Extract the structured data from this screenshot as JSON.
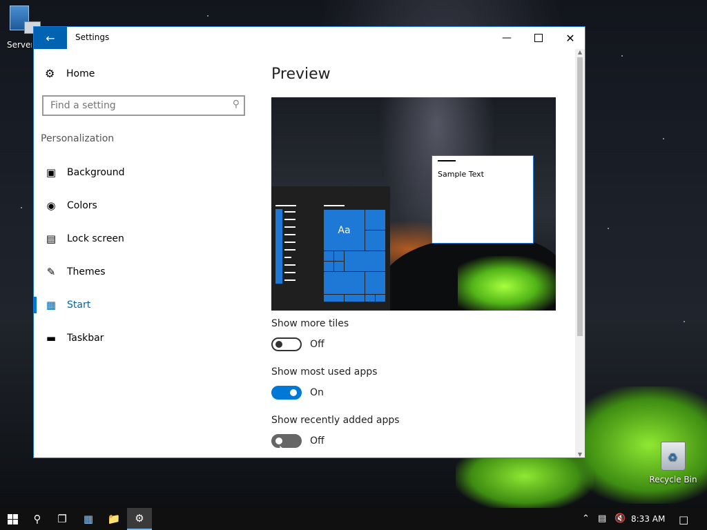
{
  "desktop": {
    "icons": [
      {
        "label": "Server Manager"
      },
      {
        "label": "Recycle Bin"
      }
    ]
  },
  "window": {
    "title": "Settings",
    "controls": {
      "minimize": "minimize-icon",
      "maximize": "maximize-icon",
      "close": "close-icon"
    }
  },
  "nav": {
    "home_label": "Home",
    "search": {
      "placeholder": "Find a setting",
      "value": ""
    },
    "section_label": "Personalization",
    "items": [
      {
        "label": "Background",
        "icon": "image-icon",
        "selected": false
      },
      {
        "label": "Colors",
        "icon": "palette-icon",
        "selected": false
      },
      {
        "label": "Lock screen",
        "icon": "lock-screen-icon",
        "selected": false
      },
      {
        "label": "Themes",
        "icon": "themes-icon",
        "selected": false
      },
      {
        "label": "Start",
        "icon": "start-tiles-icon",
        "selected": true
      },
      {
        "label": "Taskbar",
        "icon": "taskbar-icon",
        "selected": false
      }
    ]
  },
  "content": {
    "heading": "Preview",
    "preview": {
      "tile_label": "Aa",
      "sample_text": "Sample Text"
    },
    "settings": [
      {
        "label": "Show more tiles",
        "state": "Off",
        "on": false
      },
      {
        "label": "Show most used apps",
        "state": "On",
        "on": true
      },
      {
        "label": "Show recently added apps",
        "state": "Off",
        "on": false
      }
    ]
  },
  "taskbar": {
    "buttons": [
      "windows-start-icon",
      "search-icon",
      "task-view-icon",
      "server-manager-icon",
      "file-explorer-icon",
      "settings-gear-icon"
    ],
    "tray": {
      "time": "8:33 AM"
    }
  },
  "colors": {
    "accent": "#0078d7",
    "selected_text": "#0063b1",
    "taskbar": "#101010"
  }
}
